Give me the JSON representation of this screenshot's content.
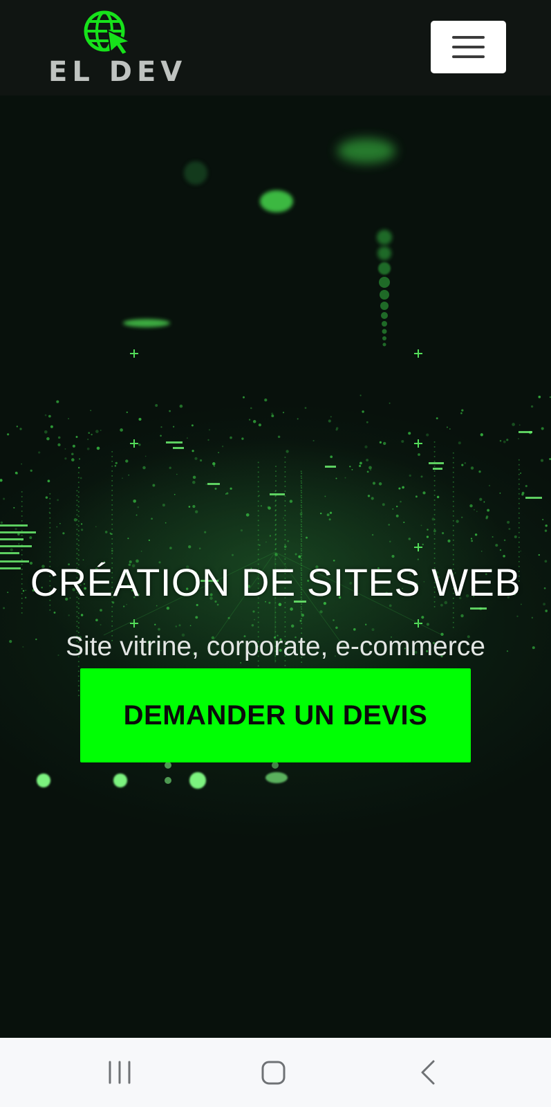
{
  "header": {
    "logo_text": "EL DEV",
    "logo_icon": "globe-cursor-icon",
    "menu_icon": "hamburger-icon"
  },
  "hero": {
    "title": "CRÉATION DE SITES WEB",
    "subtitle": "Site vitrine, corporate, e-commerce",
    "cta_label": "DEMANDER UN DEVIS"
  },
  "system_nav": {
    "recents_icon": "recent-apps-icon",
    "home_icon": "home-icon",
    "back_icon": "back-icon"
  },
  "colors": {
    "accent": "#00ff04",
    "header_bg": "#101512",
    "hero_bg": "#08110c",
    "nav_bg": "#f7f8fa"
  }
}
